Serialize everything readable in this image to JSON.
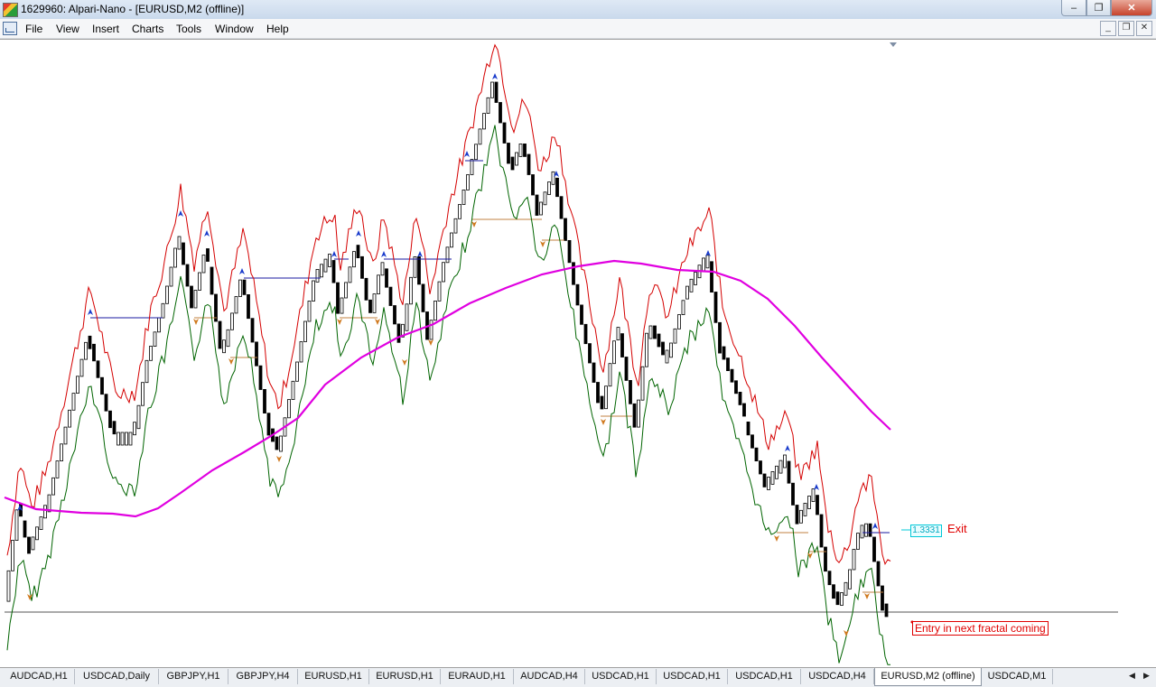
{
  "window": {
    "title": "1629960: Alpari-Nano - [EURUSD,M2 (offline)]"
  },
  "menu": [
    "File",
    "View",
    "Insert",
    "Charts",
    "Tools",
    "Window",
    "Help"
  ],
  "chart": {
    "exit_price": "1.3331",
    "exit_label": "Exit",
    "entry_note": "Entry in next fractal coming"
  },
  "tabs": [
    "AUDCAD,H1",
    "USDCAD,Daily",
    "GBPJPY,H1",
    "GBPJPY,H4",
    "EURUSD,H1",
    "EURUSD,H1",
    "EURAUD,H1",
    "AUDCAD,H4",
    "USDCAD,H1",
    "USDCAD,H1",
    "USDCAD,H1",
    "USDCAD,H4",
    "EURUSD,M2 (offline)",
    "USDCAD,M1"
  ],
  "active_tab": 12,
  "colors": {
    "upper_band": "#d40000",
    "lower_band": "#006400",
    "moving_average": "#e000e0",
    "fractal_up": "#1a3ccc",
    "fractal_down": "#d07a20",
    "exit": "#e00000",
    "price_tag": "#00c8d8"
  },
  "icons": {
    "app": "app-logo-icon",
    "chart_window": "chart-window-icon",
    "fractal_up": "fractal-up-arrow-icon",
    "fractal_down": "fractal-down-arrow-icon"
  }
}
